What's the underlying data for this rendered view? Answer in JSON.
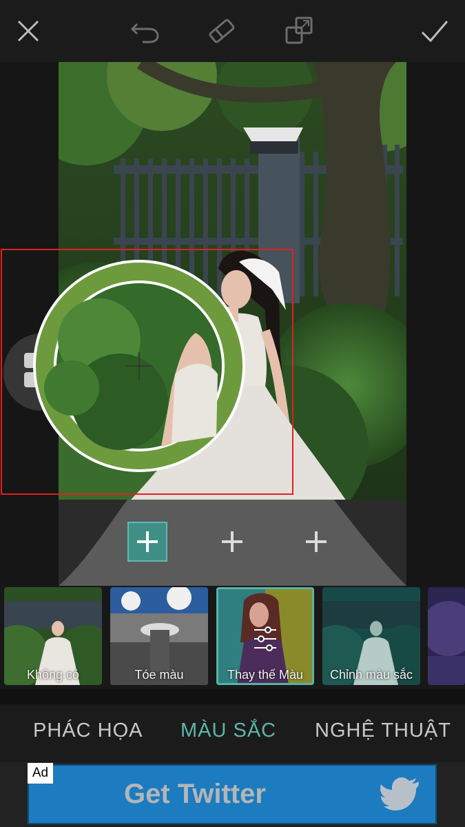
{
  "toolbar": {
    "close_icon": "close-icon",
    "undo_icon": "undo-icon",
    "eraser_icon": "eraser-icon",
    "compare_icon": "compare-icon",
    "confirm_icon": "checkmark-icon"
  },
  "editor": {
    "add_slots": [
      "plus-icon",
      "plus-icon",
      "plus-icon"
    ],
    "selected_slot_color": "#3f8f87",
    "ring_color": "#6e9a3e",
    "highlight_color": "#e02020"
  },
  "filters": [
    {
      "label": "Không có"
    },
    {
      "label": "Tóe màu"
    },
    {
      "label": "Thay thế Màu"
    },
    {
      "label": "Chỉnh màu sắc"
    },
    {
      "label": ""
    }
  ],
  "tabs": [
    {
      "label": "PHÁC HỌA"
    },
    {
      "label": "MÀU SẮC"
    },
    {
      "label": "NGHỆ THUẬT"
    }
  ],
  "active_tab_color": "#5fb5a9",
  "ad": {
    "tag": "Ad",
    "text": "Get Twitter",
    "icon": "twitter-bird-icon",
    "color": "#1d7bbf"
  }
}
